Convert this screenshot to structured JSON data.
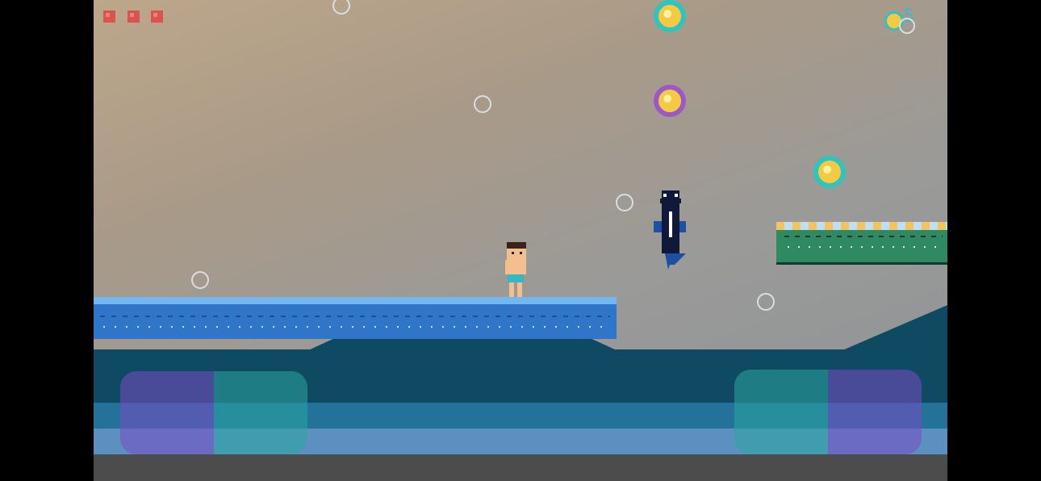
{
  "hud": {
    "lives": 3,
    "coin_count": "5",
    "coin_icon": "gold-coin-icon"
  },
  "colors": {
    "sky_warm": "#bda78a",
    "sky_cool": "#8e9196",
    "platform_blue": "#2f76c8",
    "platform_blue_top": "#74b6ef",
    "platform_green": "#2f8a62",
    "platform_green_top": "#f4c260",
    "water_deep": "#0e4a62",
    "water_mid": "#23729a",
    "water_light": "#5b90c0",
    "orb_teal": "#2ec4c0",
    "orb_purple": "#9b59c8",
    "orb_gold": "#f6c945",
    "life_red": "#d9534f"
  },
  "entities": {
    "player": "swimmer-character",
    "enemy": "orca-fish",
    "collectibles": [
      "teal-orb",
      "purple-orb",
      "teal-orb"
    ],
    "bubble_count": 6
  },
  "controls": {
    "left_pad": [
      "move-left",
      "move-right"
    ],
    "right_pad": [
      "jump",
      "swim"
    ]
  }
}
